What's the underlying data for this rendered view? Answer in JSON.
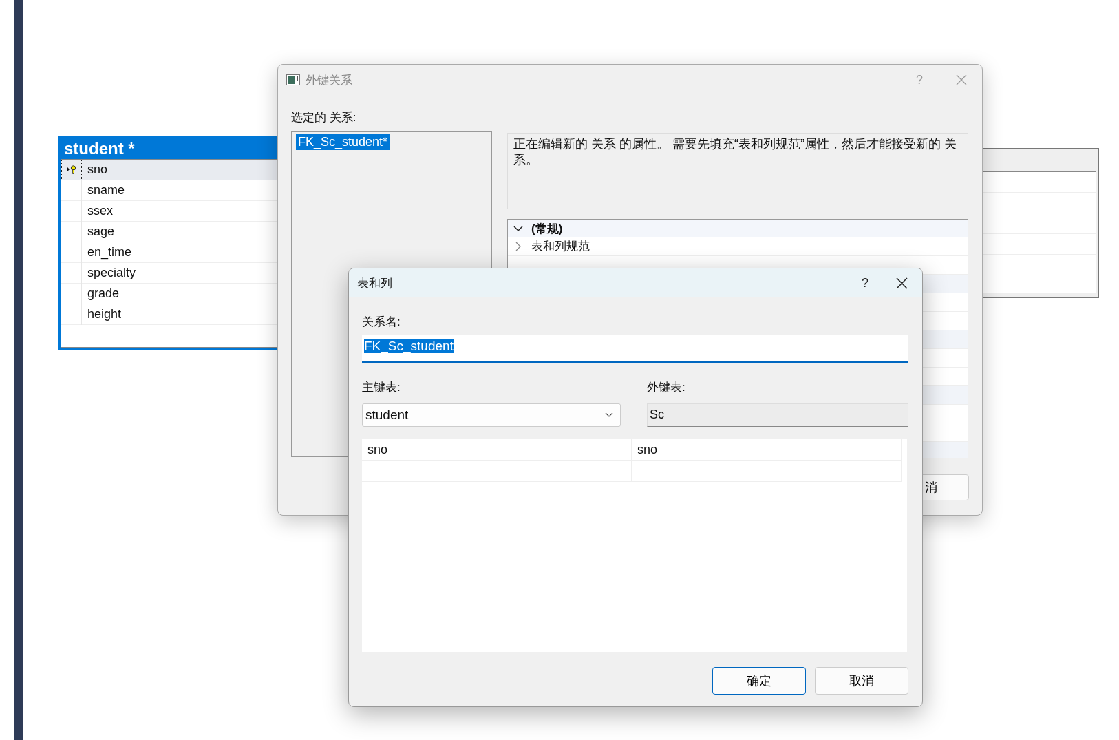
{
  "diagram_table": {
    "title": "student *",
    "columns": [
      {
        "name": "sno",
        "primary_key": true,
        "selected": true
      },
      {
        "name": "sname",
        "primary_key": false,
        "selected": false
      },
      {
        "name": "ssex",
        "primary_key": false,
        "selected": false
      },
      {
        "name": "sage",
        "primary_key": false,
        "selected": false
      },
      {
        "name": "en_time",
        "primary_key": false,
        "selected": false
      },
      {
        "name": "specialty",
        "primary_key": false,
        "selected": false
      },
      {
        "name": "grade",
        "primary_key": false,
        "selected": false
      },
      {
        "name": "height",
        "primary_key": false,
        "selected": false
      }
    ]
  },
  "outer_dialog": {
    "title": "外键关系",
    "help": "?",
    "selected_label": "选定的 关系:",
    "relations": [
      {
        "name": "FK_Sc_student*",
        "selected": true
      }
    ],
    "description": "正在编辑新的 关系 的属性。 需要先填充“表和列规范”属性，然后才能接受新的 关系。",
    "properties": [
      {
        "kind": "category",
        "label": "(常规)",
        "expanded": true
      },
      {
        "kind": "property",
        "label": "表和列规范",
        "expanded": false
      }
    ],
    "cancel_button": "消"
  },
  "inner_dialog": {
    "title": "表和列",
    "help": "?",
    "name_label": "关系名:",
    "name_value": "FK_Sc_student",
    "primary_label": "主键表:",
    "primary_table": "student",
    "foreign_label": "外键表:",
    "foreign_table": "Sc",
    "mappings": [
      {
        "primary": "sno",
        "foreign": "sno"
      }
    ],
    "ok_button": "确定",
    "cancel_button": "取消"
  }
}
